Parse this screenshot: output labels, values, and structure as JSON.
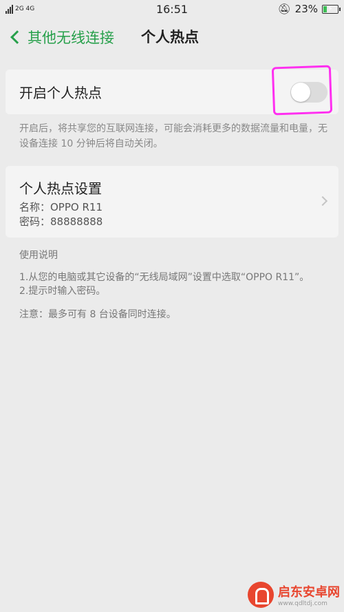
{
  "status_bar": {
    "network_label": "2G 4G",
    "time": "16:51",
    "battery_percent": "23%",
    "battery_level": 0.23,
    "icons": [
      "signal-icon",
      "bell-mute-icon",
      "battery-charging-icon"
    ]
  },
  "nav": {
    "back_label": "其他无线连接",
    "title": "个人热点"
  },
  "hotspot_toggle": {
    "label": "开启个人热点",
    "enabled": false
  },
  "description": "开启后，将共享您的互联网连接，可能会消耗更多的数据流量和电量，无设备连接 10 分钟后将自动关闭。",
  "settings": {
    "title": "个人热点设置",
    "name_line": "名称：OPPO R11",
    "password_line": "密码：88888888"
  },
  "instructions": {
    "title": "使用说明",
    "step1": "1.从您的电脑或其它设备的“无线局域网”设置中选取“OPPO R11”。",
    "step2": "2.提示时输入密码。",
    "note": "注意：最多可有 8 台设备同时连接。"
  },
  "watermark": {
    "name": "启东安卓网",
    "url": "www.qdltdj.com"
  },
  "colors": {
    "accent": "#27a04b",
    "highlight": "#ff2ef0",
    "background": "#ebebeb"
  }
}
